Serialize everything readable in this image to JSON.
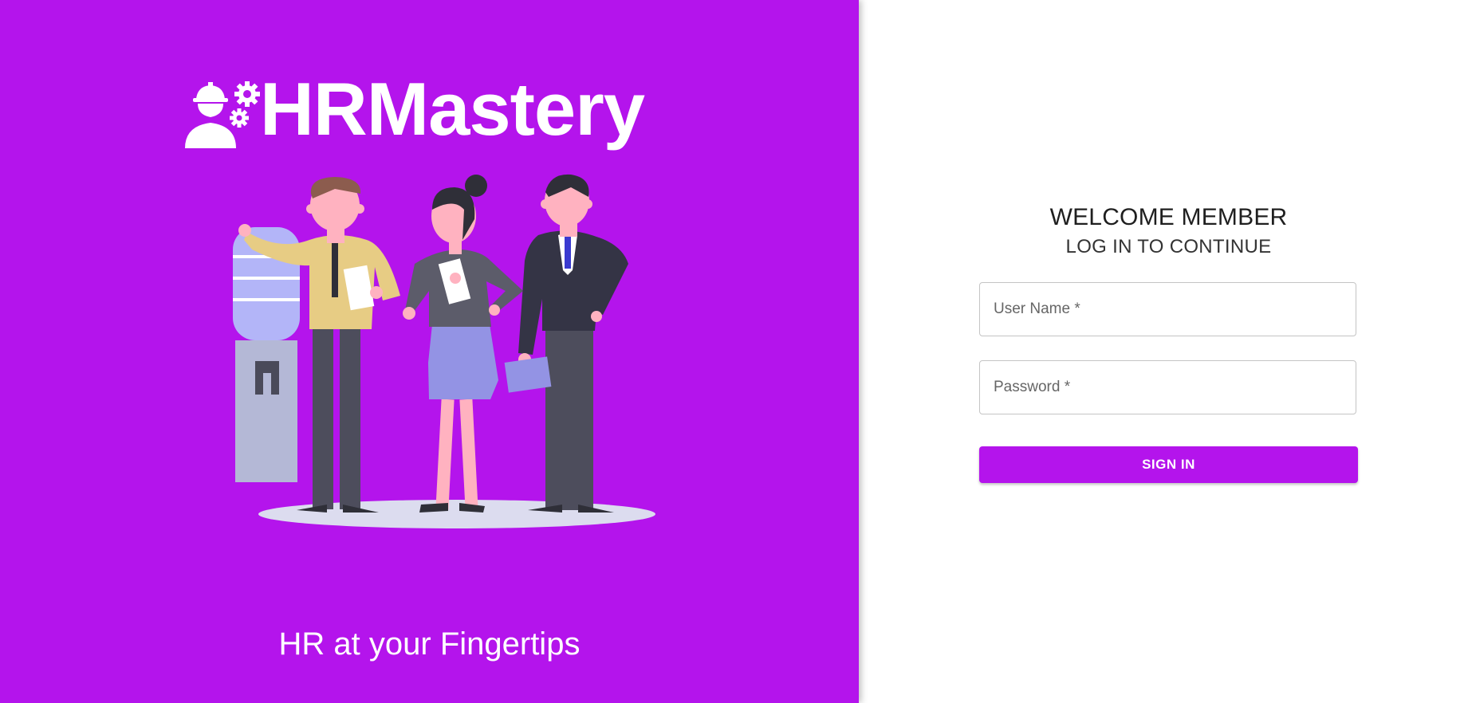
{
  "brand": {
    "name": "HRMastery",
    "icon": "hr-worker-gears-icon"
  },
  "tagline": "HR at your Fingertips",
  "login": {
    "title": "WELCOME MEMBER",
    "subtitle": "LOG IN TO CONTINUE",
    "username_placeholder": "User Name *",
    "username_value": "",
    "password_placeholder": "Password *",
    "password_value": "",
    "submit_label": "SIGN IN"
  },
  "colors": {
    "accent": "#b414ec",
    "background": "#ffffff"
  }
}
